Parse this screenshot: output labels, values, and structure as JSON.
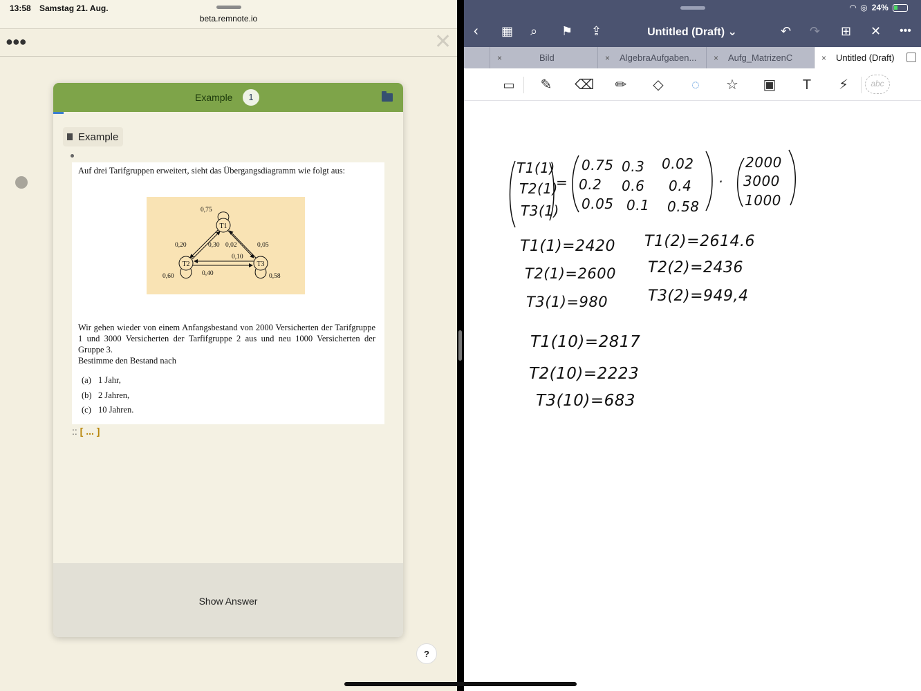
{
  "left_status": {
    "time": "13:58",
    "date": "Samstag 21. Aug.",
    "url": "beta.remnote.io"
  },
  "left_toolbar": {
    "menu_icon": "more-dots-icon",
    "close_icon": "close-icon"
  },
  "card": {
    "header_title": "Example",
    "count": "1",
    "rem_title": "Example",
    "paragraph1": "Auf drei Tarifgruppen erweitert, sieht das Übergangsdiagramm wie folgt aus:",
    "diagram": {
      "nodes": [
        "T1",
        "T2",
        "T3"
      ],
      "labels": {
        "t1_self": "0,75",
        "t2_self": "0,60",
        "t3_self": "0,58",
        "t1_t2": "0,20",
        "t2_t1": "0,30",
        "t3_t1": "0,02",
        "t1_t3": "0,05",
        "t3_t2": "0,10",
        "t2_t3": "0,40"
      }
    },
    "paragraph2": "Wir gehen wieder von einem Anfangsbestand von 2000 Versicherten der Tarifgruppe 1 und 3000 Versicherten der Tarfifgruppe 2 aus und neu 1000 Versicherten der Gruppe 3.",
    "paragraph3": "Bestimme den Bestand nach",
    "items": [
      {
        "letter": "(a)",
        "text": "1 Jahr,"
      },
      {
        "letter": "(b)",
        "text": "2 Jahren,"
      },
      {
        "letter": "(c)",
        "text": "10 Jahren."
      }
    ],
    "cloze_prefix": "::",
    "cloze": "[ ... ]",
    "show_answer": "Show Answer"
  },
  "help_label": "?",
  "right_status": {
    "battery": "24%"
  },
  "notes_toolbar": {
    "title": "Untitled (Draft)"
  },
  "tabs": [
    {
      "label": "Bild",
      "close": "×"
    },
    {
      "label": "AlgebraAufgaben...",
      "close": "×"
    },
    {
      "label": "Aufg_MatrizenC",
      "close": "×"
    },
    {
      "label": "Untitled (Draft)",
      "close": "×"
    }
  ],
  "handwriting": {
    "lhs": [
      "T1(1)",
      "T2(1)",
      "T3(1)"
    ],
    "eq": "=",
    "matrix_rows": [
      [
        "0.75",
        "0.3",
        "0.02"
      ],
      [
        "0.2",
        "0.6",
        "0.4"
      ],
      [
        "0.05",
        "0.1",
        "0.58"
      ]
    ],
    "dot": "·",
    "vector": [
      "2000",
      "3000",
      "1000"
    ],
    "col1": [
      "T1(1)=2420",
      "T2(1)=2600",
      "T3(1)=980"
    ],
    "col2": [
      "T1(2)=2614.6",
      "T2(2)=2436",
      "T3(2)=949,4"
    ],
    "col3": [
      "T1(10)=2817",
      "T2(10)=2223",
      "T3(10)=683"
    ]
  }
}
